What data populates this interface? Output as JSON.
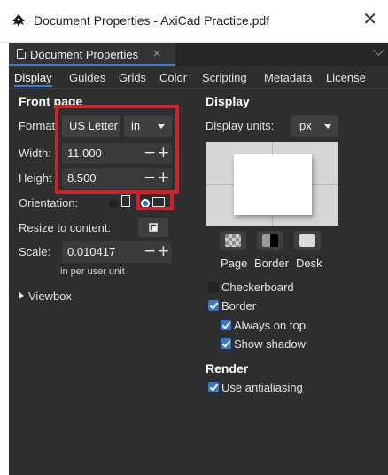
{
  "window": {
    "title": "Document Properties - AxiCad Practice.pdf"
  },
  "doc_tab": {
    "label": "Document Properties",
    "close": "×"
  },
  "tabs": [
    {
      "label": "Display",
      "active": true
    },
    {
      "label": "Guides"
    },
    {
      "label": "Grids"
    },
    {
      "label": "Color"
    },
    {
      "label": "Scripting"
    },
    {
      "label": "Metadata"
    },
    {
      "label": "License"
    }
  ],
  "front_page": {
    "heading": "Front page",
    "format_label": "Format",
    "format_value": "US Letter",
    "unit_value": "in",
    "width_label": "Width:",
    "width_value": "11.000",
    "height_label": "Height",
    "height_value": "8.500",
    "orientation_label": "Orientation:",
    "orientation_selected": "landscape",
    "resize_label": "Resize to content:",
    "scale_label": "Scale:",
    "scale_value": "0.010417",
    "scale_sub": "in per user unit",
    "viewbox_label": "Viewbox",
    "stepper_glyph": "−+"
  },
  "display": {
    "heading": "Display",
    "units_label": "Display units:",
    "units_value": "px",
    "swatch_labels": [
      "Page",
      "Border",
      "Desk"
    ],
    "checkerboard_label": "Checkerboard",
    "checkerboard_checked": false,
    "border_label": "Border",
    "border_checked": true,
    "always_on_top_label": "Always on top",
    "always_on_top_checked": true,
    "show_shadow_label": "Show shadow",
    "show_shadow_checked": true
  },
  "render": {
    "heading": "Render",
    "antialias_label": "Use antialiasing",
    "antialias_checked": true
  },
  "colors": {
    "panel_bg": "#2e2e2e",
    "accent_blue": "#3a7bd5",
    "highlight_red": "#d0202c"
  }
}
